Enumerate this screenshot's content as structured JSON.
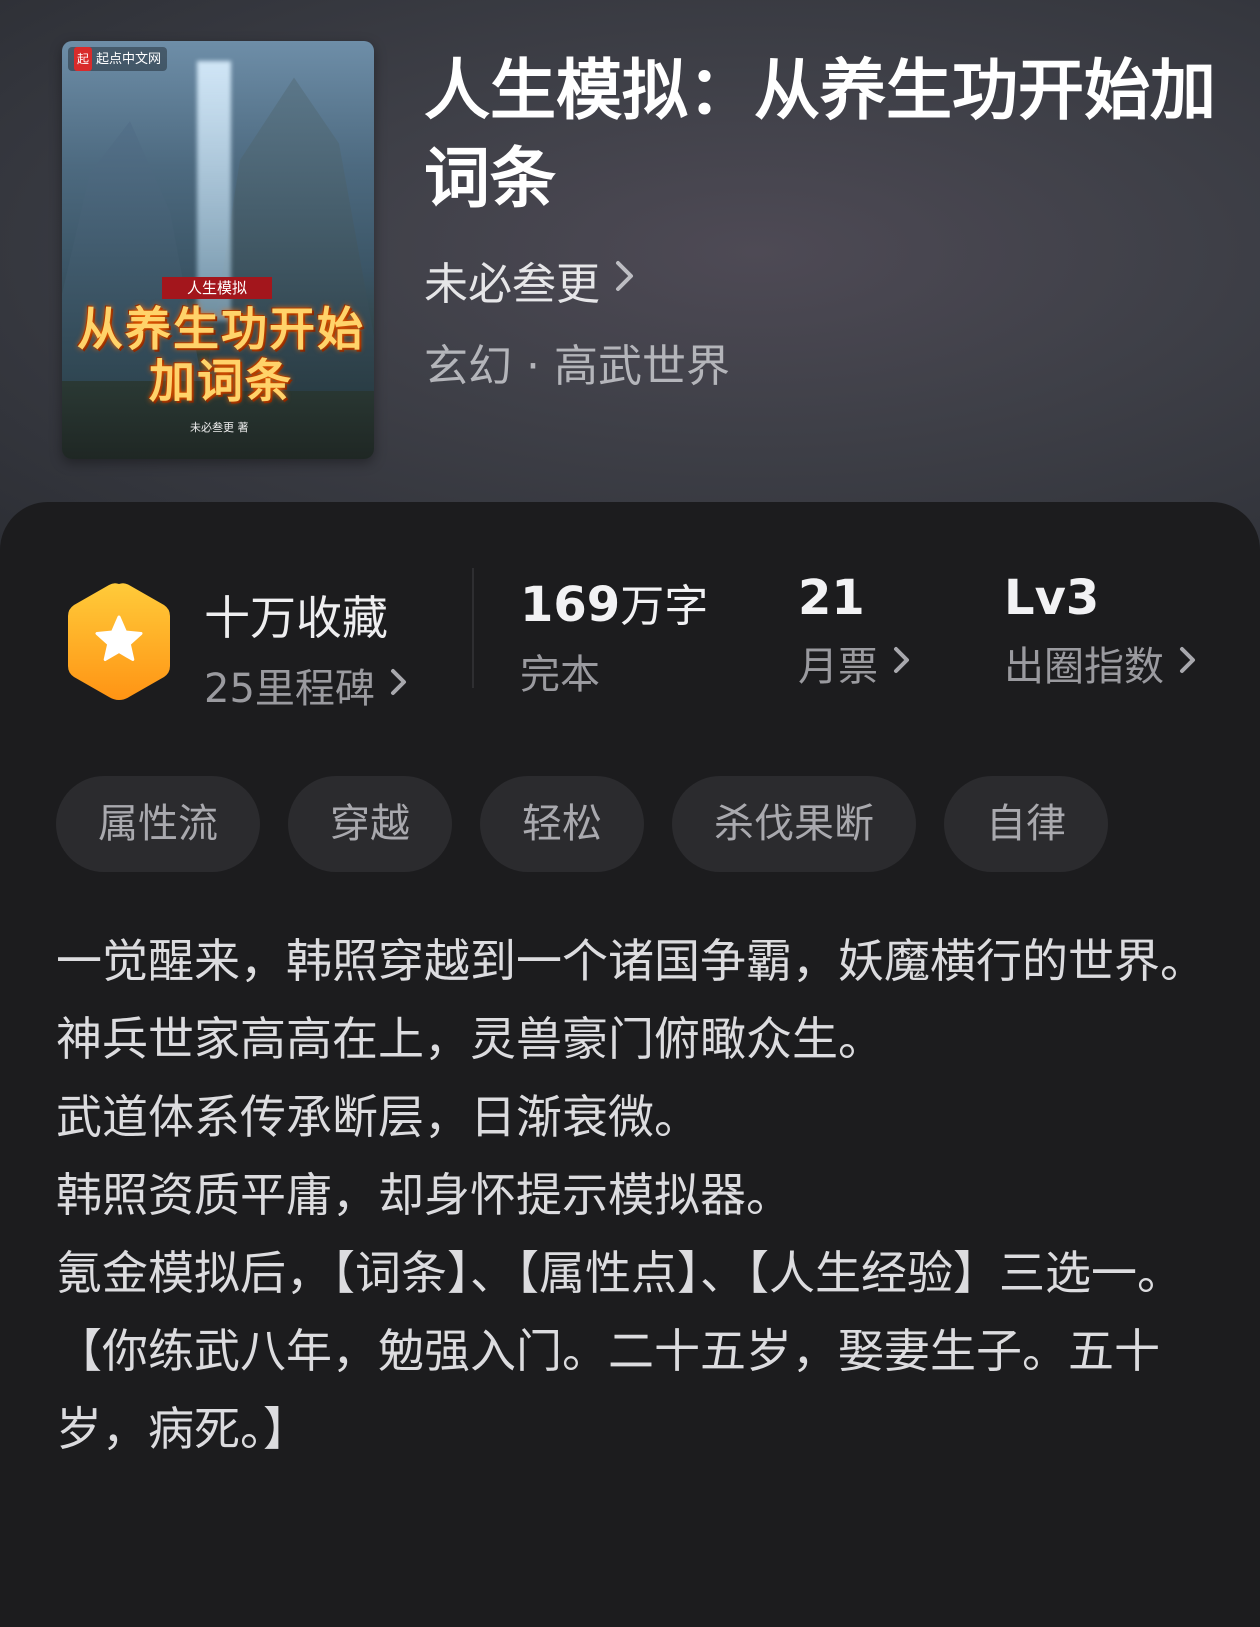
{
  "book": {
    "title": "人生模拟：从养生功开始加词条",
    "author": "未必叁更",
    "genre": "玄幻 · 高武世界"
  },
  "cover": {
    "publisher_logo": "起点中文网",
    "publisher_mark": "起",
    "ribbon": "人生模拟",
    "title": "从养生功开始加词条",
    "author_small": "未必叁更 著"
  },
  "stats": {
    "collect": {
      "title": "十万收藏",
      "subtitle": "25里程碑"
    },
    "words": {
      "value": "169",
      "unit": "万字",
      "label": "完本"
    },
    "monthly_votes": {
      "value": "21",
      "label": "月票"
    },
    "influence": {
      "value": "Lv3",
      "label": "出圈指数"
    }
  },
  "tags": [
    "属性流",
    "穿越",
    "轻松",
    "杀伐果断",
    "自律"
  ],
  "synopsis": [
    "一觉醒来，韩照穿越到一个诸国争霸，妖魔横行的世界。",
    "神兵世家高高在上，灵兽豪门俯瞰众生。",
    "武道体系传承断层，日渐衰微。",
    "韩照资质平庸，却身怀提示模拟器。",
    "氪金模拟后，【词条】、【属性点】、【人生经验】三选一。",
    "【你练武八年，勉强入门。二十五岁，娶妻生子。五十岁，病死。】"
  ],
  "colors": {
    "badge_gradient_top": "#ffc832",
    "badge_gradient_bottom": "#ff9a1a",
    "panel": "#1c1c1e",
    "tag_bg": "#2b2b2e"
  }
}
